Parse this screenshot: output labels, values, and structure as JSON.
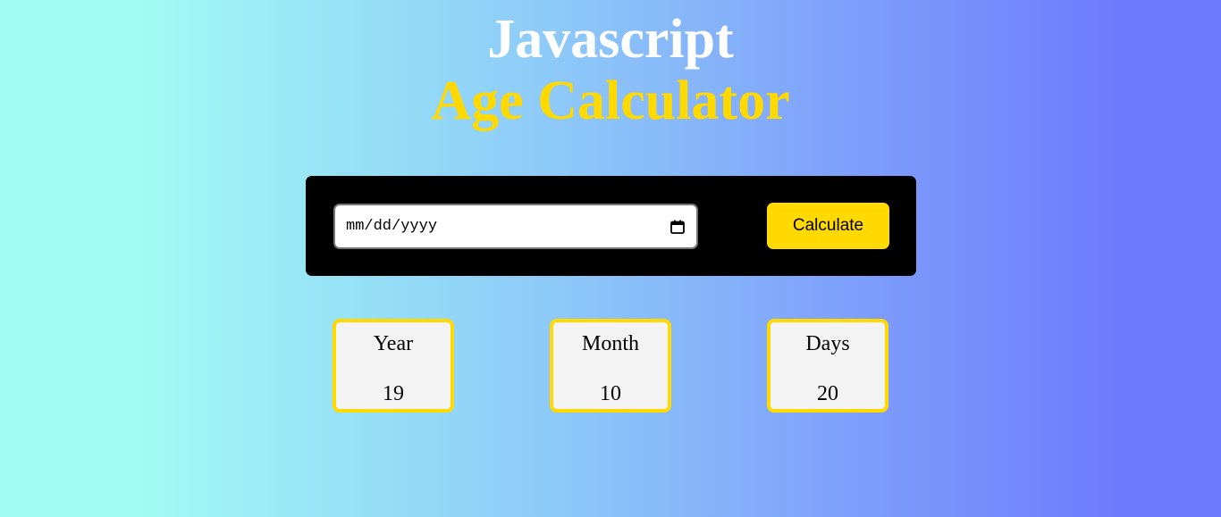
{
  "header": {
    "line1": "Javascript",
    "line2": "Age Calculator"
  },
  "form": {
    "date_placeholder": "mm/dd/yyyy",
    "date_icon": "calendar-icon",
    "calculate_label": "Calculate"
  },
  "results": {
    "year_label": "Year",
    "year_value": "19",
    "month_label": "Month",
    "month_value": "10",
    "days_label": "Days",
    "days_value": "20"
  },
  "colors": {
    "accent": "#ffd900",
    "panel": "#000000",
    "title_white": "#ffffff",
    "gradient_left": "#a1fdf4",
    "gradient_right": "#6e7afc"
  }
}
